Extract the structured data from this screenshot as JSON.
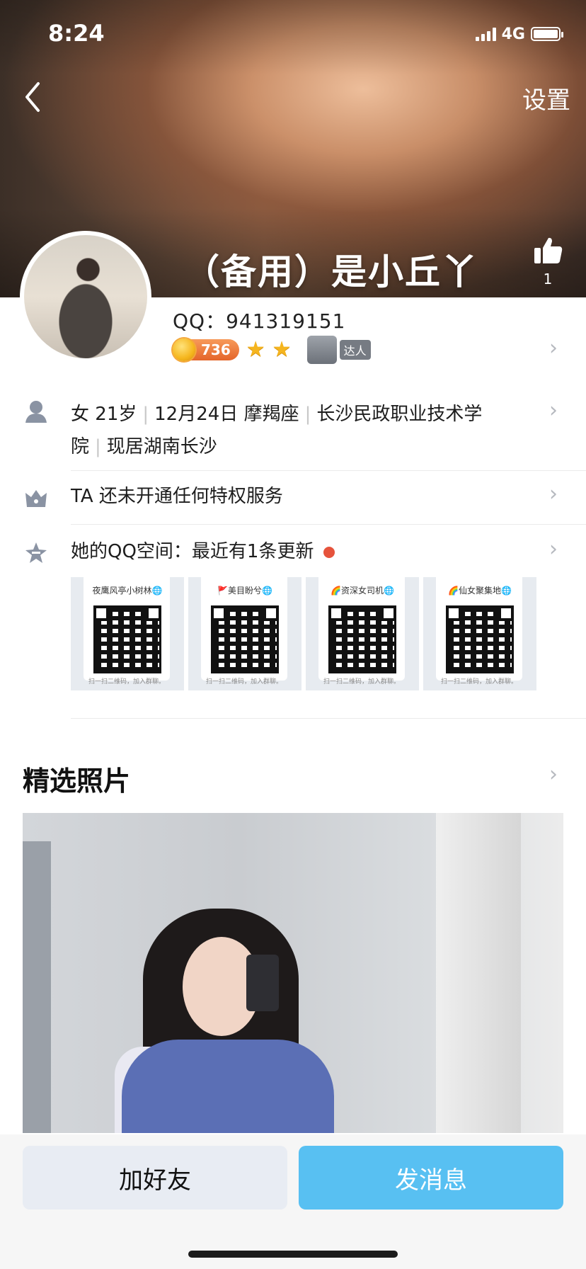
{
  "status_bar": {
    "time": "8:24",
    "network": "4G"
  },
  "header": {
    "settings_label": "设置",
    "nickname": "（备用）是小丘丫",
    "like_count": "1"
  },
  "profile": {
    "qq_label": "QQ：",
    "qq_number": "941319151",
    "coin_level": "736",
    "daren_label": "达人"
  },
  "info_rows": {
    "basic": {
      "gender": "女",
      "age": "21岁",
      "birthday": "12月24日 摩羯座",
      "school_line1": "长沙民政职业技术学",
      "school_line2": "院",
      "location": "现居湖南长沙"
    },
    "privilege": "TA 还未开通任何特权服务",
    "qzone": "她的QQ空间：最近有1条更新"
  },
  "qzone_thumbs": [
    {
      "tag": "夜鹰风亭小树林🌐",
      "foot": "扫一扫二维码，加入群聊。"
    },
    {
      "tag": "🚩美目盼兮🌐",
      "foot": "扫一扫二维码，加入群聊。"
    },
    {
      "tag": "🌈资深女司机🌐",
      "foot": "扫一扫二维码，加入群聊。"
    },
    {
      "tag": "🌈仙女聚集地🌐",
      "foot": "扫一扫二维码，加入群聊。"
    }
  ],
  "featured": {
    "title": "精选照片"
  },
  "actions": {
    "add_friend": "加好友",
    "send_message": "发消息"
  },
  "colors": {
    "accent": "#58c0f2",
    "secondary_button": "#e8ecf3",
    "update_dot": "#e6533c"
  },
  "icons": [
    "back-chevron-icon",
    "thumbs-up-icon",
    "person-icon",
    "crown-icon",
    "qzone-star-icon",
    "chevron-right-icon",
    "signal-icon",
    "battery-icon"
  ]
}
